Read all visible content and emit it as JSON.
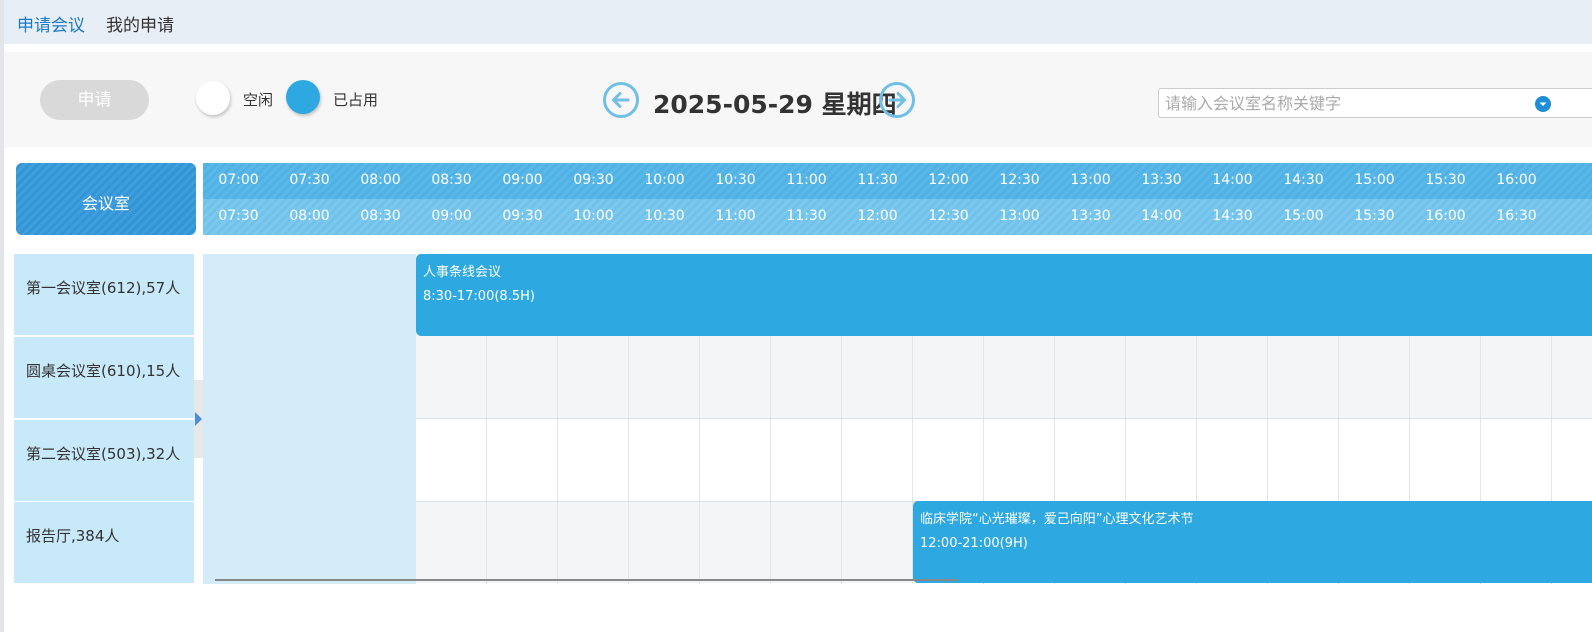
{
  "tabs": [
    "申请会议",
    "我的申请"
  ],
  "toolbar": {
    "apply_label": "申请",
    "legend_free": "空闲",
    "legend_occupied": "已占用",
    "date_label": "2025-05-29 星期四",
    "search_placeholder": "请输入会议室名称关键字"
  },
  "colors": {
    "accent": "#2ea8e1",
    "tab_active": "#1b79c9",
    "room_bg": "#c8e9f9",
    "past_bg": "#d4ecf9"
  },
  "grid": {
    "room_header": "会议室",
    "slot_starts": [
      "07:00",
      "07:30",
      "08:00",
      "08:30",
      "09:00",
      "09:30",
      "10:00",
      "10:30",
      "11:00",
      "11:30",
      "12:00",
      "12:30",
      "13:00",
      "13:30",
      "14:00",
      "14:30",
      "15:00",
      "15:30",
      "16:00"
    ],
    "slot_ends": [
      "07:30",
      "08:00",
      "08:30",
      "09:00",
      "09:30",
      "10:00",
      "10:30",
      "11:00",
      "11:30",
      "12:00",
      "12:30",
      "13:00",
      "13:30",
      "14:00",
      "14:30",
      "15:00",
      "15:30",
      "16:00",
      "16:30"
    ]
  },
  "rooms": [
    "第一会议室(612),57人",
    "圆桌会议室(610),15人",
    "第二会议室(503),32人",
    "报告厅,384人"
  ],
  "bookings": [
    {
      "room": 0,
      "start": "08:30",
      "title": "人事条线会议",
      "time": "8:30-17:00(8.5H)"
    },
    {
      "room": 3,
      "start": "12:00",
      "title": "临床学院“心光璀璨，爱己向阳”心理文化艺术节",
      "time": "12:00-21:00(9H)"
    }
  ]
}
